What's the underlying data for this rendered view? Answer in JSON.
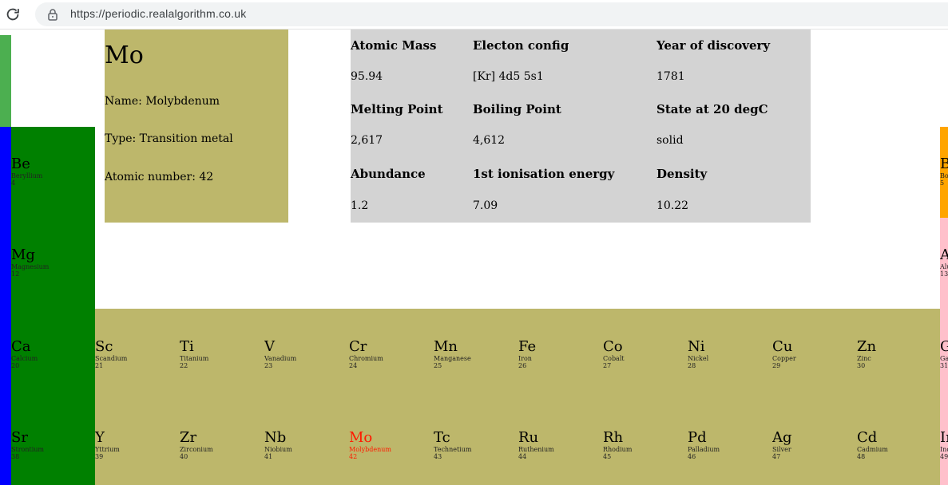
{
  "browser": {
    "url": "https://periodic.realalgorithm.co.uk",
    "reload_icon": "reload-icon",
    "lock_icon": "lock-icon"
  },
  "colors": {
    "hydrogen_strip": "#4caf50",
    "alkali": "#0000ff",
    "alkaline_earth": "#008000",
    "transition": "#bdb76b",
    "boron_group_top": "#ffa500",
    "post_transition": "#ffc0cb",
    "props_bg": "#d3d3d3",
    "selected_text": "#ff1a00"
  },
  "detail": {
    "symbol": "Mo",
    "name_line": "Name: Molybdenum",
    "type_line": "Type: Transition metal",
    "number_line": "Atomic number: 42"
  },
  "props": [
    {
      "label": "Atomic Mass",
      "value": "95.94"
    },
    {
      "label": "Electon config",
      "value": "[Kr] 4d5 5s1"
    },
    {
      "label": "Year of discovery",
      "value": "1781"
    },
    {
      "label": "Melting Point",
      "value": "2,617"
    },
    {
      "label": "Boiling Point",
      "value": "4,612"
    },
    {
      "label": "State at 20 degC",
      "value": "solid"
    },
    {
      "label": "Abundance",
      "value": "1.2"
    },
    {
      "label": "1st ionisation energy",
      "value": "7.09"
    },
    {
      "label": "Density",
      "value": "10.22"
    }
  ],
  "elements": {
    "be": {
      "symbol": "Be",
      "name": "Beryllium",
      "number": "4"
    },
    "mg": {
      "symbol": "Mg",
      "name": "Magnesium",
      "number": "12"
    },
    "ca": {
      "symbol": "Ca",
      "name": "Calcium",
      "number": "20"
    },
    "sr": {
      "symbol": "Sr",
      "name": "Strontium",
      "number": "38"
    },
    "sc": {
      "symbol": "Sc",
      "name": "Scandium",
      "number": "21"
    },
    "ti": {
      "symbol": "Ti",
      "name": "Titanium",
      "number": "22"
    },
    "v": {
      "symbol": "V",
      "name": "Vanadium",
      "number": "23"
    },
    "cr": {
      "symbol": "Cr",
      "name": "Chromium",
      "number": "24"
    },
    "mn": {
      "symbol": "Mn",
      "name": "Manganese",
      "number": "25"
    },
    "fe": {
      "symbol": "Fe",
      "name": "Iron",
      "number": "26"
    },
    "co": {
      "symbol": "Co",
      "name": "Cobalt",
      "number": "27"
    },
    "ni": {
      "symbol": "Ni",
      "name": "Nickel",
      "number": "28"
    },
    "cu": {
      "symbol": "Cu",
      "name": "Copper",
      "number": "29"
    },
    "zn": {
      "symbol": "Zn",
      "name": "Zinc",
      "number": "30"
    },
    "y": {
      "symbol": "Y",
      "name": "Yttrium",
      "number": "39"
    },
    "zr": {
      "symbol": "Zr",
      "name": "Zirconium",
      "number": "40"
    },
    "nb": {
      "symbol": "Nb",
      "name": "Niobium",
      "number": "41"
    },
    "mo": {
      "symbol": "Mo",
      "name": "Molybdenum",
      "number": "42"
    },
    "tc": {
      "symbol": "Tc",
      "name": "Technetium",
      "number": "43"
    },
    "ru": {
      "symbol": "Ru",
      "name": "Ruthenium",
      "number": "44"
    },
    "rh": {
      "symbol": "Rh",
      "name": "Rhodium",
      "number": "45"
    },
    "pd": {
      "symbol": "Pd",
      "name": "Palladium",
      "number": "46"
    },
    "ag": {
      "symbol": "Ag",
      "name": "Silver",
      "number": "47"
    },
    "cd": {
      "symbol": "Cd",
      "name": "Cadmium",
      "number": "48"
    },
    "b": {
      "symbol": "B",
      "name": "Bo",
      "number": "5"
    },
    "al": {
      "symbol": "A",
      "name": "Alu",
      "number": "13"
    },
    "ga": {
      "symbol": "G",
      "name": "Ga",
      "number": "31"
    },
    "in": {
      "symbol": "In",
      "name": "Ind",
      "number": "49"
    }
  }
}
